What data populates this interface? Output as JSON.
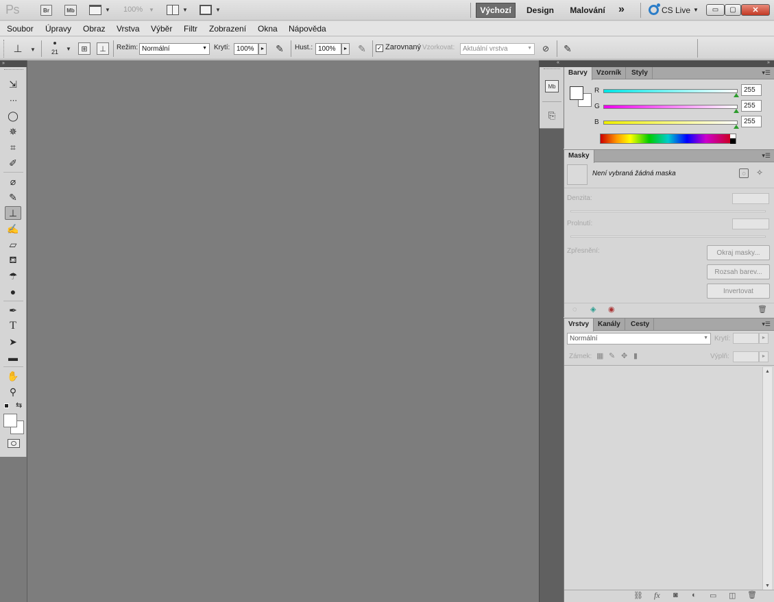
{
  "appbar": {
    "logo": "Ps",
    "bridge": "Br",
    "minibridge": "Mb",
    "zoom": "100%",
    "workspaces": [
      "Výchozí",
      "Design",
      "Malování"
    ],
    "more": "»",
    "cslive": "CS Live",
    "window_min": "▭",
    "window_max": "▢",
    "window_close": "✕"
  },
  "menu": [
    "Soubor",
    "Úpravy",
    "Obraz",
    "Vrstva",
    "Výběr",
    "Filtr",
    "Zobrazení",
    "Okna",
    "Nápověda"
  ],
  "options": {
    "brush_size": "21",
    "mode_label": "Režim:",
    "mode_value": "Normální",
    "opacity_label": "Krytí:",
    "opacity_value": "100%",
    "flow_label": "Hust.:",
    "flow_value": "100%",
    "aligned_label": "Zarovnaný",
    "sample_label": "Vzorkovat:",
    "sample_value": "Aktuální vrstva"
  },
  "tools": [
    "move-tool",
    "marquee-tool",
    "lasso-tool",
    "magic-wand-tool",
    "crop-tool",
    "eyedropper-tool",
    "healing-brush-tool",
    "brush-tool",
    "clone-stamp-tool",
    "history-brush-tool",
    "eraser-tool",
    "paint-bucket-tool",
    "blur-tool",
    "dodge-tool",
    "pen-tool",
    "type-tool",
    "path-selection-tool",
    "rectangle-tool",
    "hand-tool",
    "zoom-tool"
  ],
  "type_tool_glyph": "T",
  "dock": {
    "collapse_left": "»",
    "collapse_right": "«",
    "minibridge_label": "Mb"
  },
  "color_panel": {
    "tabs": [
      "Barvy",
      "Vzorník",
      "Styly"
    ],
    "channels": [
      {
        "label": "R",
        "value": "255",
        "color": "#00d8d8"
      },
      {
        "label": "G",
        "value": "255",
        "color": "#e600e6"
      },
      {
        "label": "B",
        "value": "255",
        "color": "#e6e600"
      }
    ]
  },
  "masks_panel": {
    "tab": "Masky",
    "no_mask": "Není vybraná žádná maska",
    "density_label": "Denzita:",
    "feather_label": "Prolnutí:",
    "refine_label": "Zpřesnění:",
    "buttons": [
      "Okraj masky...",
      "Rozsah barev...",
      "Invertovat"
    ]
  },
  "layers_panel": {
    "tabs": [
      "Vrstvy",
      "Kanály",
      "Cesty"
    ],
    "blend_mode": "Normální",
    "opacity_label": "Krytí:",
    "lock_label": "Zámek:",
    "fill_label": "Výplň:",
    "fx_label": "fx"
  }
}
